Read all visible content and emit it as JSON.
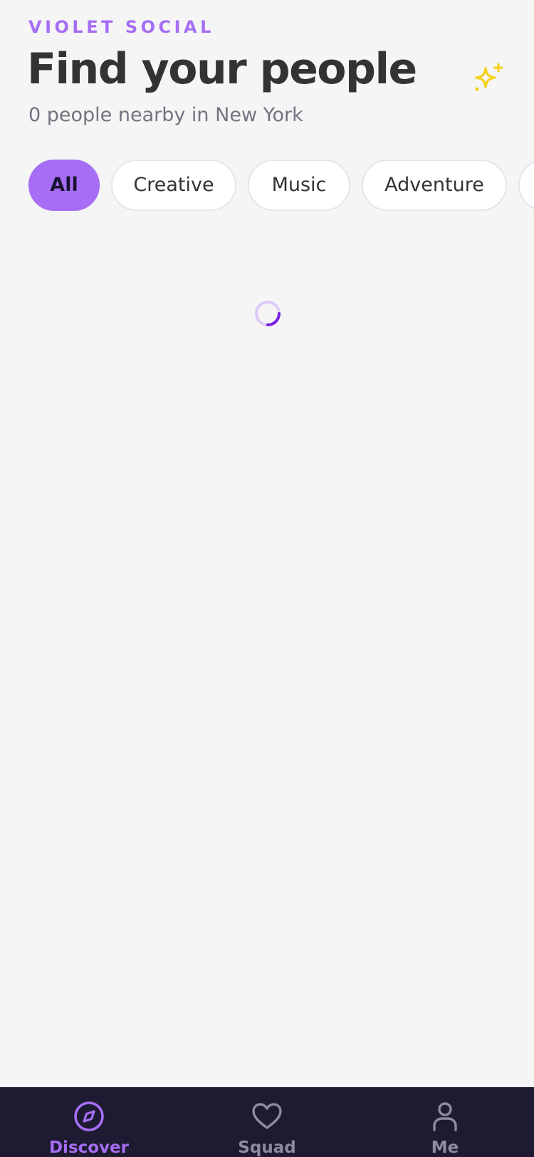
{
  "header": {
    "brand": "VIOLET SOCIAL",
    "title": "Find your people",
    "subtitle": "0 people nearby in New York",
    "action_icon": "sparkle-icon"
  },
  "filters": [
    {
      "label": "All",
      "selected": true
    },
    {
      "label": "Creative",
      "selected": false
    },
    {
      "label": "Music",
      "selected": false
    },
    {
      "label": "Adventure",
      "selected": false
    },
    {
      "label": "",
      "selected": false
    }
  ],
  "content": {
    "state": "loading",
    "indicator_icon": "loading-spinner-icon"
  },
  "tabbar": {
    "items": [
      {
        "label": "Discover",
        "icon": "compass-icon",
        "active": true
      },
      {
        "label": "Squad",
        "icon": "heart-icon",
        "active": false
      },
      {
        "label": "Me",
        "icon": "person-icon",
        "active": false
      }
    ]
  },
  "colors": {
    "accent": "#a66ef5",
    "background": "#f5f5f5",
    "tabbar_background": "#1e1a31",
    "sparkle": "#f5d21e",
    "spinner_track": "#dccbf7",
    "spinner_arc": "#7a1ee0"
  }
}
